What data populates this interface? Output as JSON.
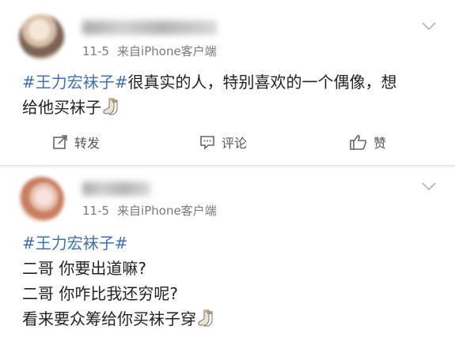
{
  "posts": [
    {
      "time": "11-5",
      "source": "来自iPhone客户端",
      "topic": "#王力宏袜子#",
      "text_line1": "很真实的人，特别喜欢的一个偶像，想",
      "text_line2": "给他买袜子",
      "actions": {
        "repost": "转发",
        "comment": "评论",
        "like": "赞"
      }
    },
    {
      "time": "11-5",
      "source": "来自iPhone客户端",
      "topic": "#王力宏袜子#",
      "lines": [
        "二哥 你要出道嘛?",
        "二哥 你咋比我还穷呢?",
        "看来要众筹给你买袜子穿"
      ]
    }
  ],
  "icons": {
    "dropdown": "chevron-down-icon",
    "repost": "repost-icon",
    "comment": "comment-icon",
    "like": "thumbs-up-icon",
    "emoji": "socks-emoji"
  },
  "colors": {
    "topic": "#3f6fb4",
    "meta": "#7a7a7a",
    "text": "#222222"
  }
}
